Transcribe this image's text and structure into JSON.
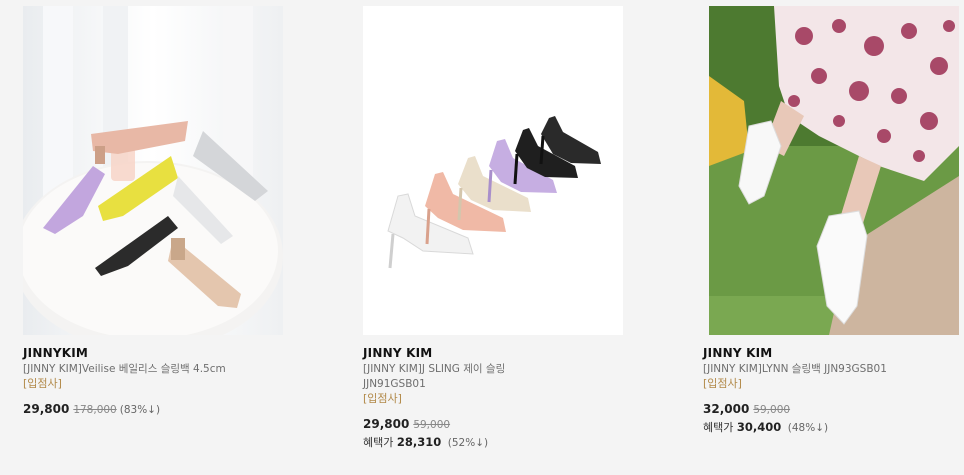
{
  "products": [
    {
      "brand": "JINNYKIM",
      "name": "[JINNY KIM]Veilise 베일리스 슬링백 4.5cm",
      "badge": "[입점사]",
      "price": "29,800",
      "original_price": "178,000",
      "discount": "(83%↓)"
    },
    {
      "brand": "JINNY KIM",
      "name": "[JINNY KIM]J SLING 제이 슬링",
      "code": "JJN91GSB01",
      "badge": "[입점사]",
      "price": "29,800",
      "original_price": "59,000",
      "benefit_label": "혜택가",
      "benefit_price": "28,310",
      "benefit_discount": "(52%↓)"
    },
    {
      "brand": "JINNY KIM",
      "name": "[JINNY KIM]LYNN 슬링백 JJN93GSB01",
      "badge": "[입점사]",
      "price": "32,000",
      "original_price": "59,000",
      "benefit_label": "혜택가",
      "benefit_price": "30,400",
      "benefit_discount": "(48%↓)"
    }
  ]
}
